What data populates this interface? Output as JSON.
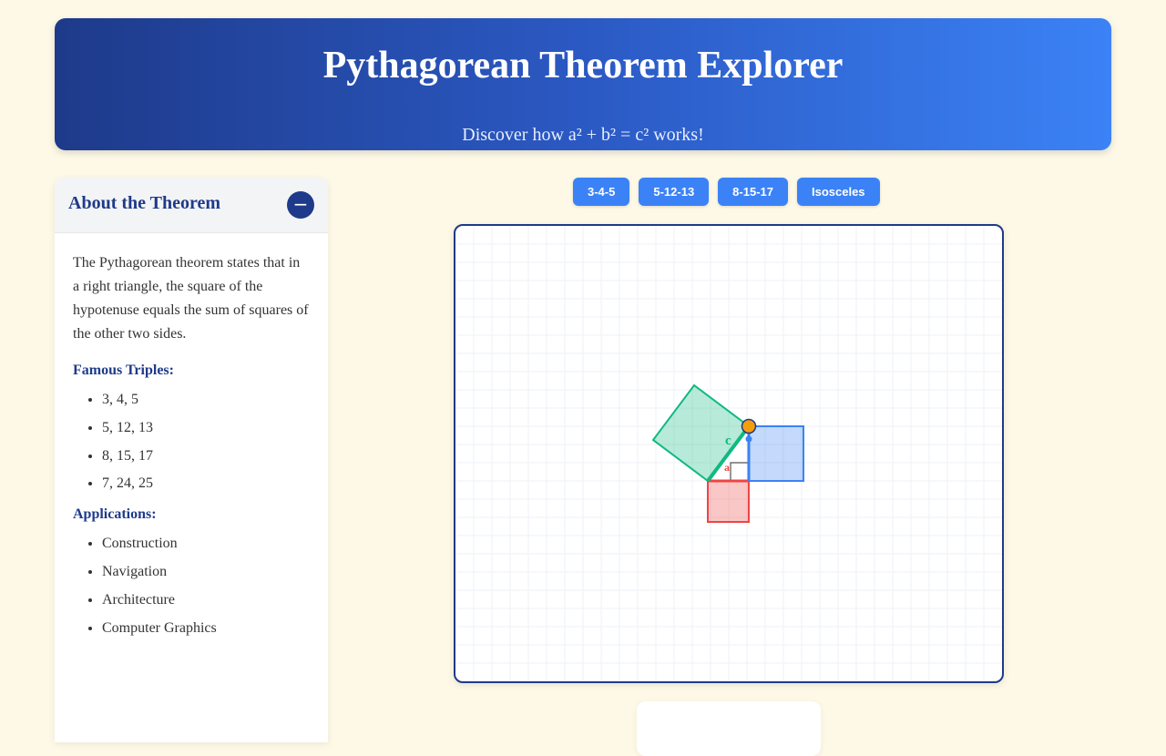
{
  "header": {
    "title": "Pythagorean Theorem Explorer",
    "subtitle": "Discover how a² + b² = c² works!"
  },
  "about_panel": {
    "title": "About the Theorem",
    "toggle_icon": "−",
    "description": "The Pythagorean theorem states that in a right triangle, the square of the hypotenuse equals the sum of squares of the other two sides.",
    "triples_heading": "Famous Triples:",
    "triples": [
      "3, 4, 5",
      "5, 12, 13",
      "8, 15, 17",
      "7, 24, 25"
    ],
    "applications_heading": "Applications:",
    "applications": [
      "Construction",
      "Navigation",
      "Architecture",
      "Computer Graphics"
    ]
  },
  "presets": [
    "3-4-5",
    "5-12-13",
    "8-15-17",
    "Isosceles"
  ],
  "canvas": {
    "labels": {
      "a": "a",
      "c": "c"
    },
    "colors": {
      "square_a": "#ef4444",
      "square_b": "#3b82f6",
      "square_c": "#10b981",
      "grid": "#eef2f7",
      "handle_fill": "#f59e0b"
    }
  },
  "colors": {
    "page_bg": "#fef9e7",
    "header_start": "#1e3a8a",
    "header_end": "#3b82f6",
    "accent": "#1e3a8a",
    "button": "#3b82f6"
  }
}
